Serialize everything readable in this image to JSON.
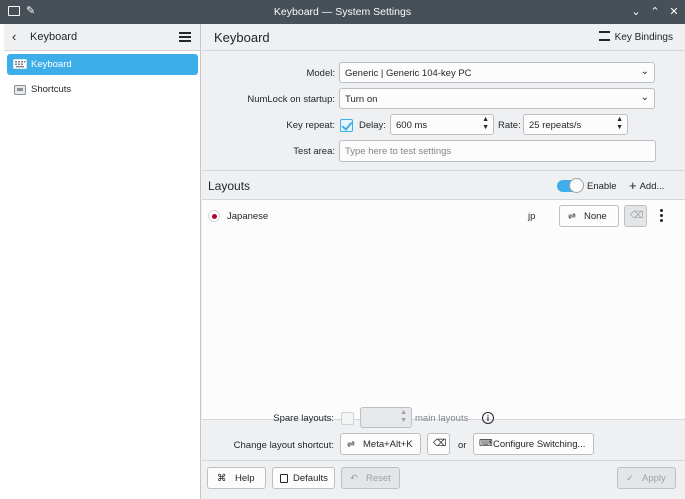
{
  "window": {
    "title": "Keyboard — System Settings"
  },
  "sidebar": {
    "title": "Keyboard",
    "items": [
      {
        "label": "Keyboard",
        "icon": "keyboard-icon",
        "active": true
      },
      {
        "label": "Shortcuts",
        "icon": "shortcuts-icon",
        "active": false
      }
    ]
  },
  "main": {
    "title": "Keyboard",
    "key_bindings_label": "Key Bindings",
    "model_label": "Model:",
    "model_value": "Generic | Generic 104-key PC",
    "numlock_label": "NumLock on startup:",
    "numlock_value": "Turn on",
    "key_repeat_label": "Key repeat:",
    "delay_label": "Delay:",
    "delay_value": "600 ms",
    "rate_label": "Rate:",
    "rate_value": "25 repeats/s",
    "test_area_label": "Test area:",
    "test_area_placeholder": "Type here to test settings"
  },
  "layouts": {
    "title": "Layouts",
    "enable_label": "Enable",
    "add_label": "Add...",
    "rows": [
      {
        "name": "Japanese",
        "code": "jp",
        "variant_button": "None"
      }
    ]
  },
  "bottom": {
    "spare_layouts_label": "Spare layouts:",
    "main_layouts_label": "main layouts",
    "change_shortcut_label": "Change layout shortcut:",
    "shortcut_value": "Meta+Alt+K",
    "or_label": "or",
    "configure_switching_label": "Configure Switching..."
  },
  "buttons": {
    "help": "Help",
    "defaults": "Defaults",
    "reset": "Reset",
    "apply": "Apply"
  },
  "colors": {
    "accent": "#3daee9",
    "titlebar": "#475057",
    "background": "#eff0f1"
  }
}
